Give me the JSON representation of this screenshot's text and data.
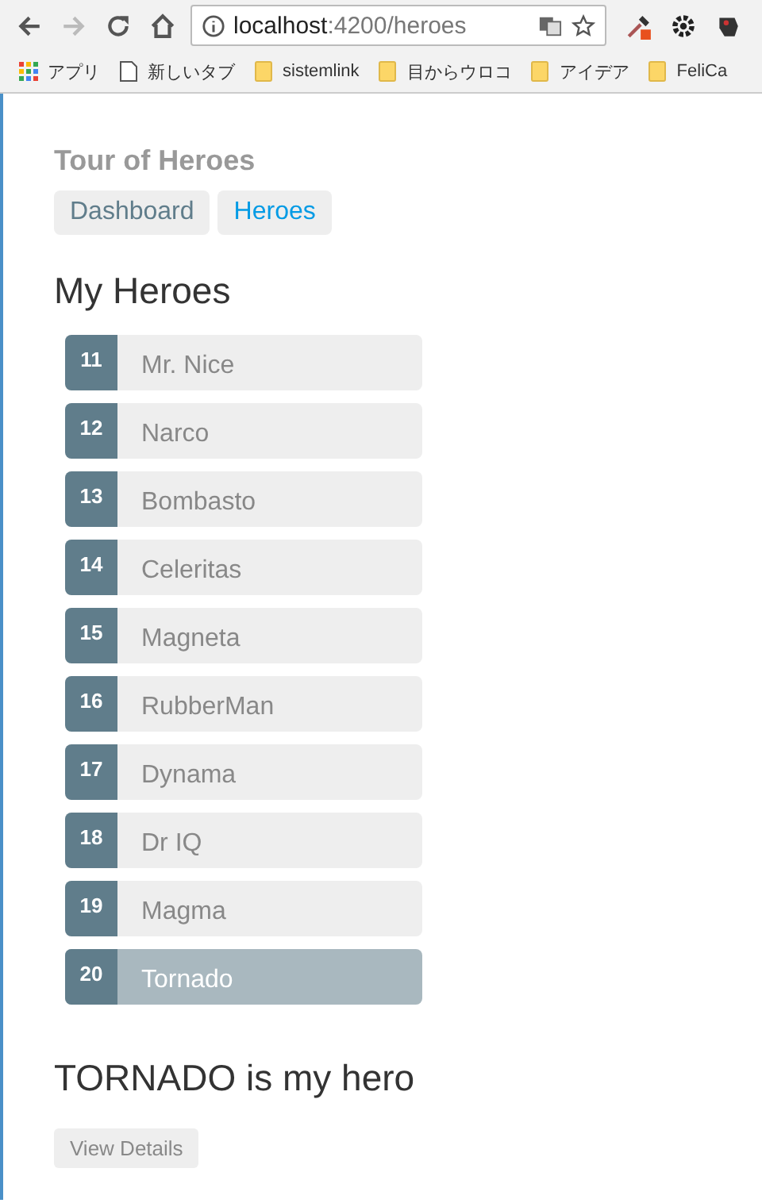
{
  "browser": {
    "url_host": "localhost",
    "url_path": ":4200/heroes",
    "bookmarks": [
      {
        "kind": "apps",
        "label": "アプリ"
      },
      {
        "kind": "page",
        "label": "新しいタブ"
      },
      {
        "kind": "folder",
        "label": "sistemlink"
      },
      {
        "kind": "folder",
        "label": "目からウロコ"
      },
      {
        "kind": "folder",
        "label": "アイデア"
      },
      {
        "kind": "folder",
        "label": "FeliCa"
      }
    ]
  },
  "app_title": "Tour of Heroes",
  "nav": [
    {
      "label": "Dashboard",
      "selected": false
    },
    {
      "label": "Heroes",
      "selected": true
    }
  ],
  "heading": "My Heroes",
  "heroes": [
    {
      "id": "11",
      "name": "Mr. Nice",
      "selected": false
    },
    {
      "id": "12",
      "name": "Narco",
      "selected": false
    },
    {
      "id": "13",
      "name": "Bombasto",
      "selected": false
    },
    {
      "id": "14",
      "name": "Celeritas",
      "selected": false
    },
    {
      "id": "15",
      "name": "Magneta",
      "selected": false
    },
    {
      "id": "16",
      "name": "RubberMan",
      "selected": false
    },
    {
      "id": "17",
      "name": "Dynama",
      "selected": false
    },
    {
      "id": "18",
      "name": "Dr IQ",
      "selected": false
    },
    {
      "id": "19",
      "name": "Magma",
      "selected": false
    },
    {
      "id": "20",
      "name": "Tornado",
      "selected": true
    }
  ],
  "detail_heading": "TORNADO is my hero",
  "detail_button": "View Details"
}
